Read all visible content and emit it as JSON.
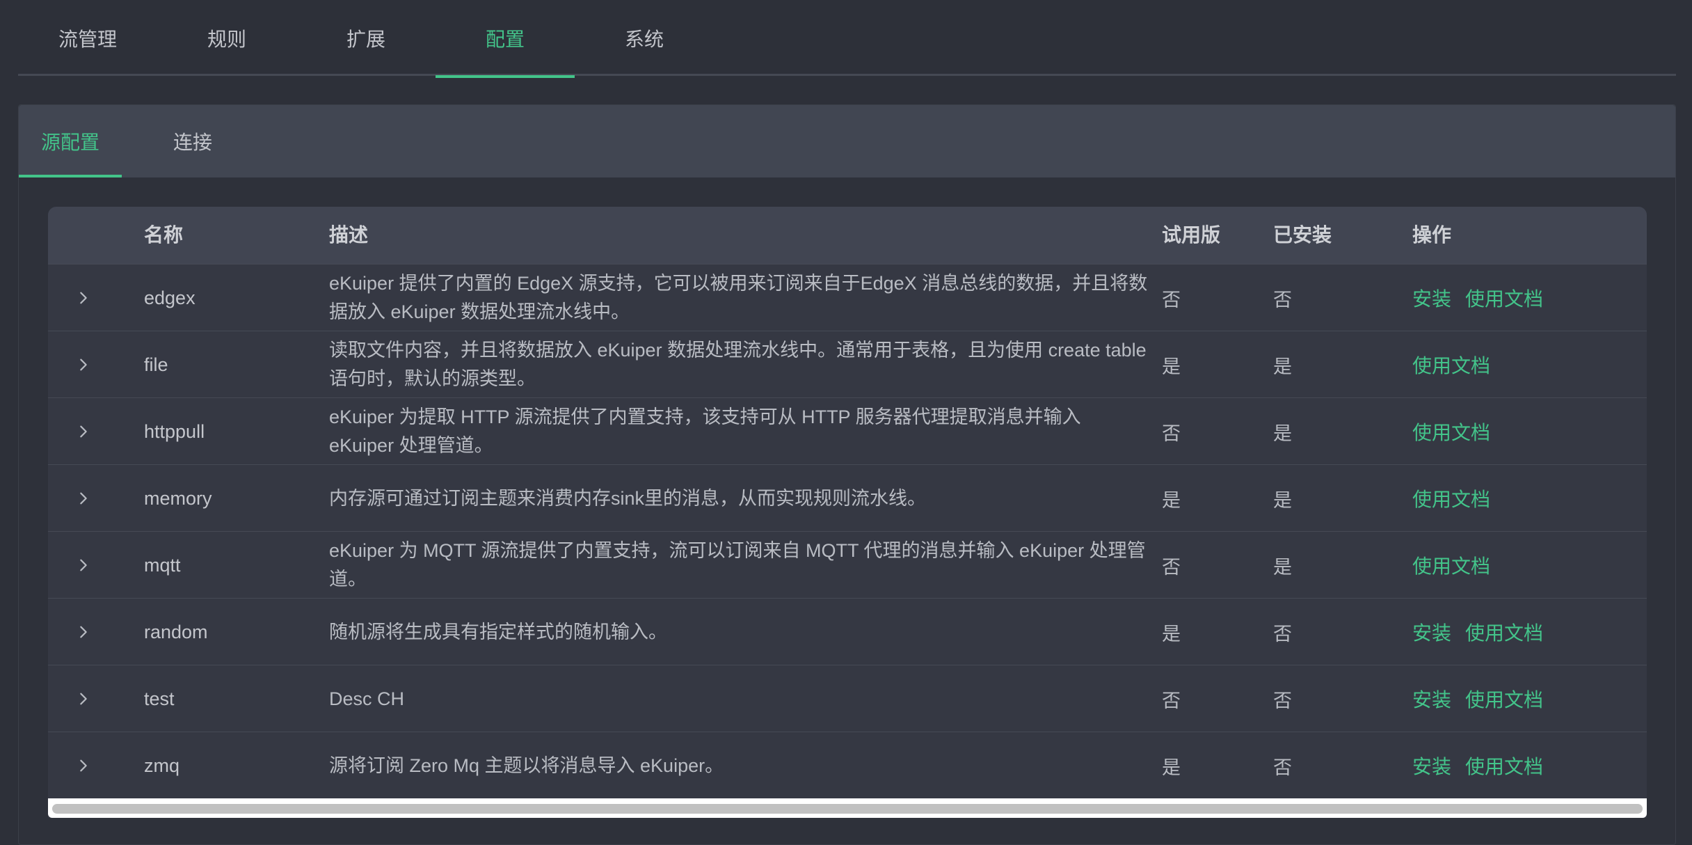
{
  "top_tabs": [
    "流管理",
    "规则",
    "扩展",
    "配置",
    "系统"
  ],
  "active_top_tab": "配置",
  "sub_tabs": [
    "源配置",
    "连接"
  ],
  "active_sub_tab": "源配置",
  "table": {
    "headers": {
      "name": "名称",
      "desc": "描述",
      "trial": "试用版",
      "installed": "已安装",
      "ops": "操作"
    },
    "rows": [
      {
        "name": "edgex",
        "desc": "eKuiper 提供了内置的 EdgeX 源支持，它可以被用来订阅来自于EdgeX 消息总线的数据，并且将数据放入 eKuiper 数据处理流水线中。",
        "trial": "否",
        "installed": "否",
        "install": "安装",
        "docs": "使用文档"
      },
      {
        "name": "file",
        "desc": "读取文件内容，并且将数据放入 eKuiper 数据处理流水线中。通常用于表格，且为使用 create table 语句时，默认的源类型。",
        "trial": "是",
        "installed": "是",
        "install": "",
        "docs": "使用文档"
      },
      {
        "name": "httppull",
        "desc": "eKuiper 为提取 HTTP 源流提供了内置支持，该支持可从 HTTP 服务器代理提取消息并输入 eKuiper 处理管道。",
        "trial": "否",
        "installed": "是",
        "install": "",
        "docs": "使用文档"
      },
      {
        "name": "memory",
        "desc": "内存源可通过订阅主题来消费内存sink里的消息，从而实现规则流水线。",
        "trial": "是",
        "installed": "是",
        "install": "",
        "docs": "使用文档"
      },
      {
        "name": "mqtt",
        "desc": "eKuiper 为 MQTT 源流提供了内置支持，流可以订阅来自 MQTT 代理的消息并输入 eKuiper 处理管道。",
        "trial": "否",
        "installed": "是",
        "install": "",
        "docs": "使用文档"
      },
      {
        "name": "random",
        "desc": "随机源将生成具有指定样式的随机输入。",
        "trial": "是",
        "installed": "否",
        "install": "安装",
        "docs": "使用文档"
      },
      {
        "name": "test",
        "desc": "Desc CH",
        "trial": "否",
        "installed": "否",
        "install": "安装",
        "docs": "使用文档"
      },
      {
        "name": "zmq",
        "desc": "源将订阅 Zero Mq 主题以将消息导入 eKuiper。",
        "trial": "是",
        "installed": "否",
        "install": "安装",
        "docs": "使用文档"
      }
    ]
  },
  "colors": {
    "accent": "#43c48a",
    "background": "#2d3039",
    "header": "#414552"
  }
}
